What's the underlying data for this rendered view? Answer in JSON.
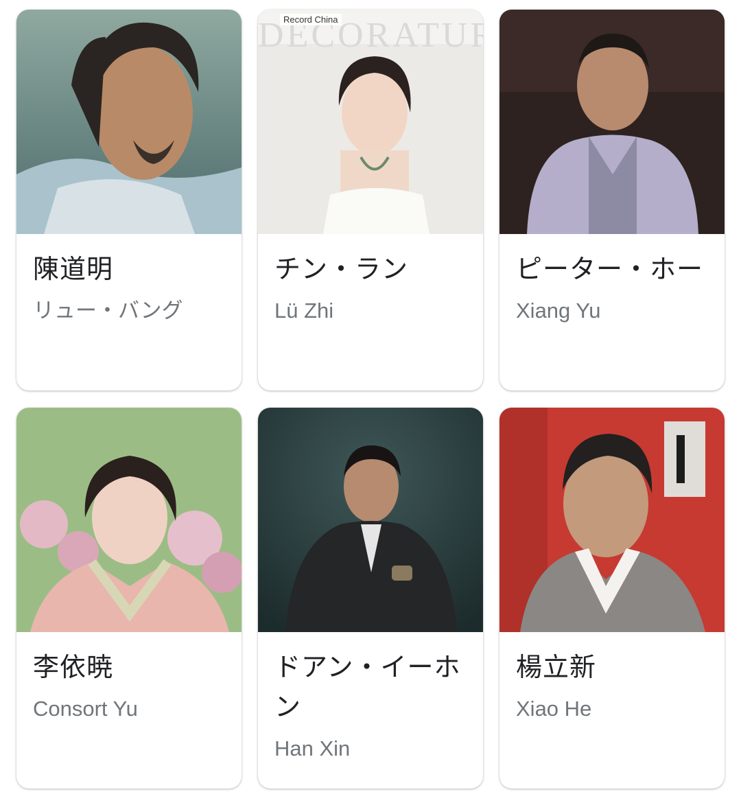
{
  "cast": [
    {
      "name": "陳道明",
      "role": "リュー・バング",
      "photo_icon": "actor-photo"
    },
    {
      "name": "チン・ラン",
      "role": "Lü Zhi",
      "photo_icon": "actor-photo",
      "photo_watermark": "Record China",
      "photo_banner": "DECORATURA"
    },
    {
      "name": "ピーター・ホー",
      "role": "Xiang Yu",
      "photo_icon": "actor-photo"
    },
    {
      "name": "李依暁",
      "role": "Consort Yu",
      "photo_icon": "actor-photo"
    },
    {
      "name": "ドアン・イーホン",
      "role": "Han Xin",
      "photo_icon": "actor-photo"
    },
    {
      "name": "楊立新",
      "role": "Xiao He",
      "photo_icon": "actor-photo"
    }
  ],
  "colors": {
    "name_text": "#202124",
    "role_text": "#70757a",
    "card_bg": "#ffffff"
  }
}
